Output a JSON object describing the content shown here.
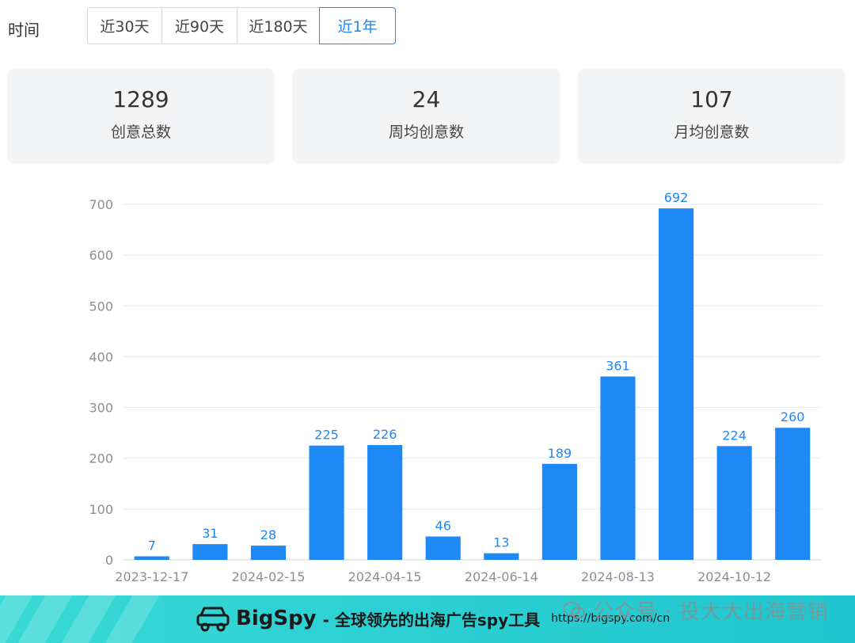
{
  "filter": {
    "label": "时间",
    "options": [
      "近30天",
      "近90天",
      "近180天",
      "近1年"
    ],
    "selected": "近1年"
  },
  "stats": [
    {
      "value": "1289",
      "label": "创意总数"
    },
    {
      "value": "24",
      "label": "周均创意数"
    },
    {
      "value": "107",
      "label": "月均创意数"
    }
  ],
  "colors": {
    "accent": "#1e88f5",
    "bar": "#1e88f5",
    "banner": "#2ccfd2"
  },
  "chart_data": {
    "type": "bar",
    "x_tick_labels": [
      "2023-12-17",
      "2024-02-15",
      "2024-04-15",
      "2024-06-14",
      "2024-08-13",
      "2024-10-12"
    ],
    "values": [
      7,
      31,
      28,
      225,
      226,
      46,
      13,
      189,
      361,
      692,
      224,
      260
    ],
    "data_labels": [
      "7",
      "31",
      "28",
      "225",
      "226",
      "46",
      "13",
      "189",
      "361",
      "692",
      "224",
      "260"
    ],
    "ylim": [
      0,
      700
    ],
    "yticks": [
      0,
      100,
      200,
      300,
      400,
      500,
      600,
      700
    ],
    "grid": true,
    "title": "",
    "xlabel": "",
    "ylabel": ""
  },
  "banner": {
    "icon": "car-logo-icon",
    "brand": "BigSpy",
    "slogan": "- 全球领先的出海广告spy工具",
    "url": "https://bigspy.com/cn"
  },
  "watermark": {
    "icon": "wechat-icon",
    "text": "公众号 · 投大大出海营销"
  }
}
